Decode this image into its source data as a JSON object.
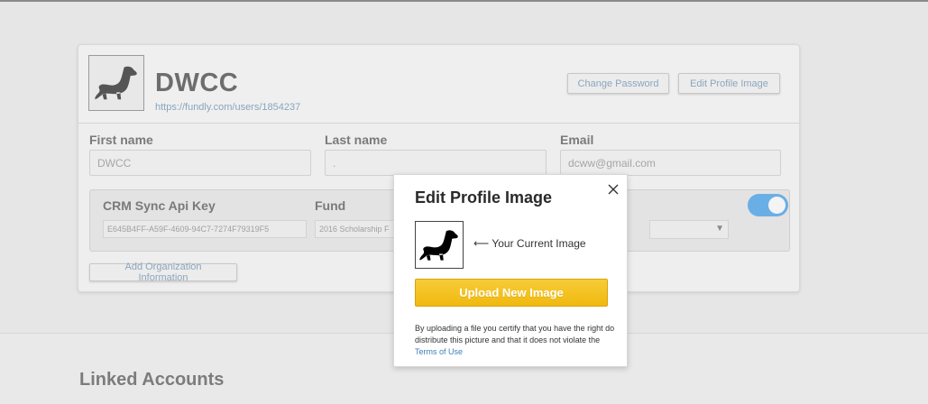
{
  "profile": {
    "org_name": "DWCC",
    "url": "https://fundly.com/users/1854237",
    "change_password_label": "Change Password",
    "edit_image_label": "Edit Profile Image"
  },
  "form": {
    "first_name_label": "First name",
    "first_name_value": "DWCC",
    "last_name_label": "Last name",
    "last_name_value": ".",
    "email_label": "Email",
    "email_value": "dcww@gmail.com"
  },
  "crm": {
    "api_key_label": "CRM Sync Api Key",
    "api_key_value": "E645B4FF-A59F-4609-94C7-7274F79319F5",
    "fund_label": "Fund",
    "fund_value": "2016 Scholarship F",
    "toggle_on": true
  },
  "add_org_label": "Add Organization Information",
  "linked_accounts_title": "Linked Accounts",
  "modal": {
    "title": "Edit Profile Image",
    "current_caption": "⟵ Your Current Image",
    "upload_label": "Upload New Image",
    "disclaimer_text": "By uploading a file you certify that you have the right do distribute this picture and that it does not violate the ",
    "terms_link": "Terms of Use"
  },
  "colors": {
    "accent_blue": "#6aaee6",
    "upload_yellow": "#f0b90f",
    "link_blue": "#3d7fb8"
  }
}
